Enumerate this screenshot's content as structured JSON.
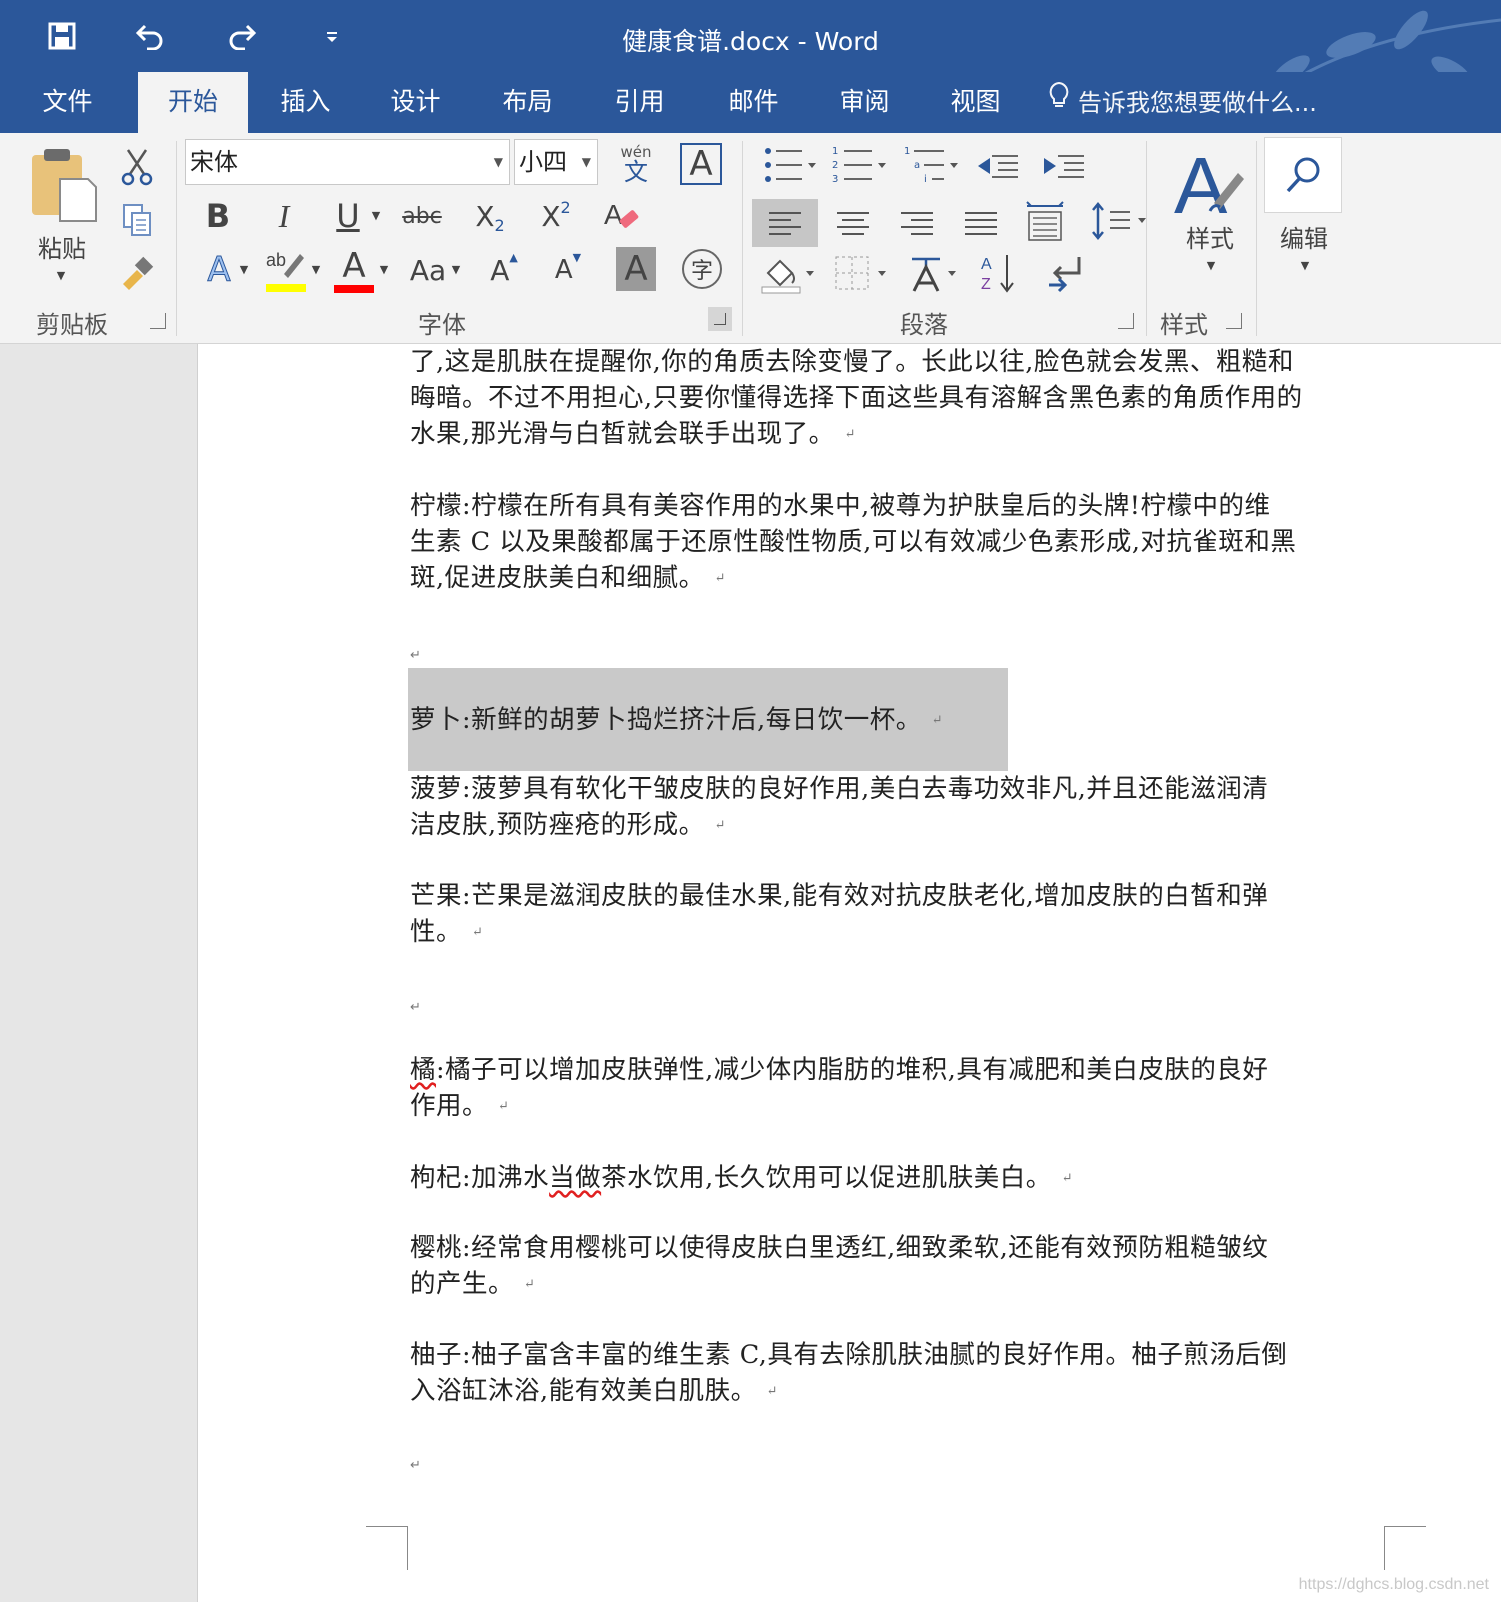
{
  "window": {
    "title": "健康食谱.docx - Word"
  },
  "quick_access": {
    "icons": [
      "save-icon",
      "undo-icon",
      "redo-icon",
      "customize-qat-icon"
    ]
  },
  "tabs": [
    {
      "label": "文件"
    },
    {
      "label": "开始"
    },
    {
      "label": "插入"
    },
    {
      "label": "设计"
    },
    {
      "label": "布局"
    },
    {
      "label": "引用"
    },
    {
      "label": "邮件"
    },
    {
      "label": "审阅"
    },
    {
      "label": "视图"
    }
  ],
  "active_tab": "开始",
  "tell_me": "告诉我您想要做什么...",
  "ribbon": {
    "clipboard": {
      "paste_label": "粘贴",
      "group_label": "剪贴板"
    },
    "font": {
      "font_name": "宋体",
      "font_size": "小四",
      "phonetic_top": "wén",
      "phonetic_bottom": "文",
      "bold": "B",
      "italic": "I",
      "underline": "U",
      "strike": "abc",
      "subscript_base": "X",
      "subscript_num": "2",
      "superscript_base": "X",
      "superscript_num": "2",
      "change_case": "Aa",
      "grow": "A",
      "shrink": "A",
      "shading_char": "A",
      "enclose_char": "字",
      "group_label": "字体",
      "highlight_color": "#ffff00",
      "font_color": "#ff0000"
    },
    "paragraph": {
      "group_label": "段落"
    },
    "styles": {
      "button_label": "样式",
      "group_label": "样式"
    },
    "editing": {
      "button_label": "编辑"
    }
  },
  "document": {
    "paragraphs": [
      {
        "text": "了,这是肌肤在提醒你,你的角质去除变慢了。长此以往,脸色就会发黑、粗糙和\n晦暗。不过不用担心,只要你懂得选择下面这些具有溶解含黑色素的角质作用的\n水果,那光滑与白皙就会联手出现了。"
      },
      {
        "text": "柠檬:柠檬在所有具有美容作用的水果中,被尊为护肤皇后的头牌!柠檬中的维\n生素 C 以及果酸都属于还原性酸性物质,可以有效减少色素形成,对抗雀斑和黑\n斑,促进皮肤美白和细腻。"
      },
      {
        "text": "萝卜:新鲜的胡萝卜捣烂挤汁后,每日饮一杯。"
      },
      {
        "text": "菠萝:菠萝具有软化干皱皮肤的良好作用,美白去毒功效非凡,并且还能滋润清\n洁皮肤,预防痤疮的形成。"
      },
      {
        "text": "芒果:芒果是滋润皮肤的最佳水果,能有效对抗皮肤老化,增加皮肤的白皙和弹\n性。"
      },
      {
        "text_prefix": "橘",
        "text": ":橘子可以增加皮肤弹性,减少体内脂肪的堆积,具有减肥和美白皮肤的良好\n作用。"
      },
      {
        "text_a": "枸杞:加沸水",
        "text_squiggle": "当做",
        "text_b": "茶水饮用,长久饮用可以促进肌肤美白。"
      },
      {
        "text": "樱桃:经常食用樱桃可以使得皮肤白里透红,细致柔软,还能有效预防粗糙皱纹\n的产生。"
      },
      {
        "text": "柚子:柚子富含丰富的维生素 C,具有去除肌肤油腻的良好作用。柚子煎汤后倒\n入浴缸沐浴,能有效美白肌肤。"
      }
    ],
    "paragraph_mark": "↵"
  },
  "watermark": "https://dghcs.blog.csdn.net",
  "colors": {
    "word_blue": "#2b579a",
    "ribbon_bg": "#f3f3f3",
    "selection_gray": "#c9c9c9"
  }
}
